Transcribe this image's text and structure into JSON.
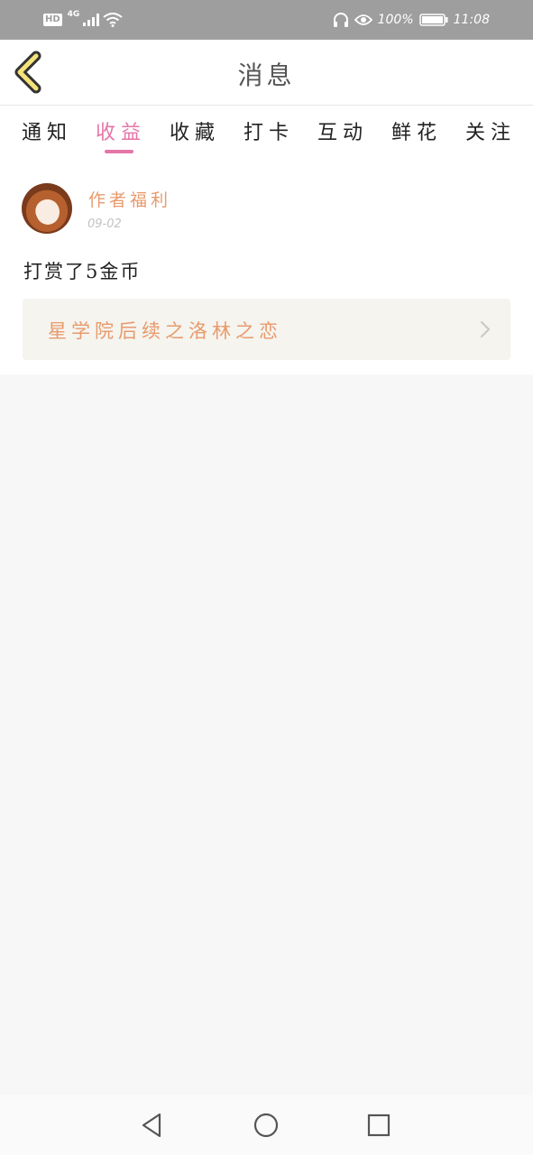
{
  "status_bar": {
    "hd_badge": "HD",
    "network": "4G",
    "battery_percent": "100%",
    "time": "11:08",
    "icons": [
      "signal-icon",
      "wifi-icon",
      "headphones-icon",
      "eye-icon",
      "battery-icon"
    ]
  },
  "header": {
    "title": "消息",
    "back_icon": "chevron-left-icon"
  },
  "tabs": [
    {
      "label": "通知",
      "active": false
    },
    {
      "label": "收益",
      "active": true
    },
    {
      "label": "收藏",
      "active": false
    },
    {
      "label": "打卡",
      "active": false
    },
    {
      "label": "互动",
      "active": false
    },
    {
      "label": "鲜花",
      "active": false
    },
    {
      "label": "关注",
      "active": false
    }
  ],
  "messages": [
    {
      "sender": "作者福利",
      "date": "09-02",
      "text": "打赏了5金币",
      "book_title": "星学院后续之洛林之恋"
    }
  ],
  "colors": {
    "accent": "#e476a8",
    "orange_text": "#e89a6c",
    "status_bar": "#9e9e9e",
    "back_icon": "#f4e27a"
  },
  "nav_bar": {
    "icons": [
      "back-triangle-icon",
      "home-circle-icon",
      "recents-square-icon"
    ]
  }
}
